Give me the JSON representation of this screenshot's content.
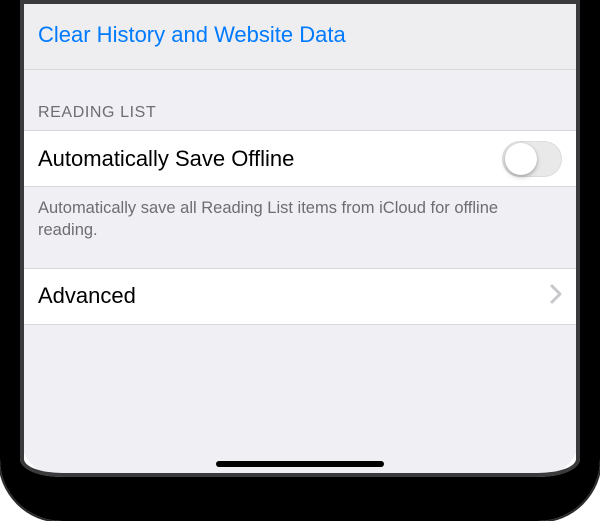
{
  "clear": {
    "label": "Clear History and Website Data"
  },
  "readingList": {
    "header": "READING LIST",
    "autoSave": {
      "label": "Automatically Save Offline",
      "on": false
    },
    "footer": "Automatically save all Reading List items from iCloud for offline reading."
  },
  "advanced": {
    "label": "Advanced"
  },
  "colors": {
    "link": "#007aff"
  }
}
